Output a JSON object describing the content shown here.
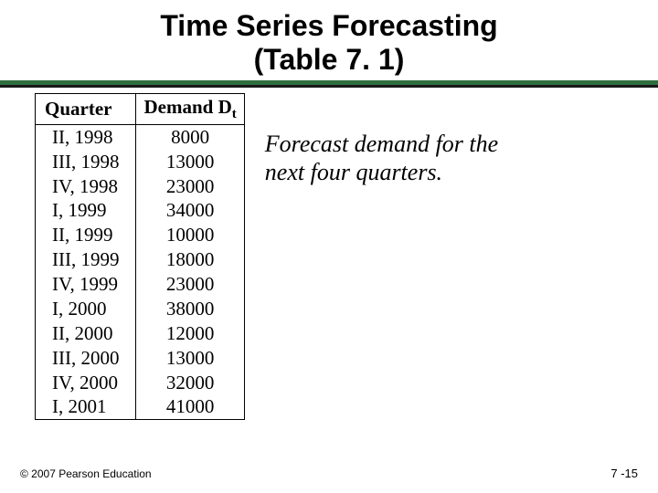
{
  "title": {
    "line1": "Time Series Forecasting",
    "line2": "(Table 7. 1)"
  },
  "table": {
    "headers": {
      "quarter": "Quarter",
      "demand_prefix": "Demand D",
      "demand_sub": "t"
    },
    "rows": [
      {
        "quarter": "II, 1998",
        "demand": "8000"
      },
      {
        "quarter": "III, 1998",
        "demand": "13000"
      },
      {
        "quarter": "IV, 1998",
        "demand": "23000"
      },
      {
        "quarter": "I, 1999",
        "demand": "34000"
      },
      {
        "quarter": "II, 1999",
        "demand": "10000"
      },
      {
        "quarter": "III, 1999",
        "demand": "18000"
      },
      {
        "quarter": "IV, 1999",
        "demand": "23000"
      },
      {
        "quarter": "I, 2000",
        "demand": "38000"
      },
      {
        "quarter": "II, 2000",
        "demand": "12000"
      },
      {
        "quarter": "III, 2000",
        "demand": "13000"
      },
      {
        "quarter": "IV, 2000",
        "demand": "32000"
      },
      {
        "quarter": "I, 2001",
        "demand": "41000"
      }
    ]
  },
  "caption": "Forecast demand for the next four quarters.",
  "footer": {
    "left": "© 2007 Pearson Education",
    "right": "7 -15"
  },
  "chart_data": {
    "type": "table",
    "title": "Time Series Forecasting (Table 7.1)",
    "columns": [
      "Quarter",
      "Demand Dt"
    ],
    "rows": [
      [
        "II, 1998",
        8000
      ],
      [
        "III, 1998",
        13000
      ],
      [
        "IV, 1998",
        23000
      ],
      [
        "I, 1999",
        34000
      ],
      [
        "II, 1999",
        10000
      ],
      [
        "III, 1999",
        18000
      ],
      [
        "IV, 1999",
        23000
      ],
      [
        "I, 2000",
        38000
      ],
      [
        "II, 2000",
        12000
      ],
      [
        "III, 2000",
        13000
      ],
      [
        "IV, 2000",
        32000
      ],
      [
        "I, 2001",
        41000
      ]
    ]
  }
}
